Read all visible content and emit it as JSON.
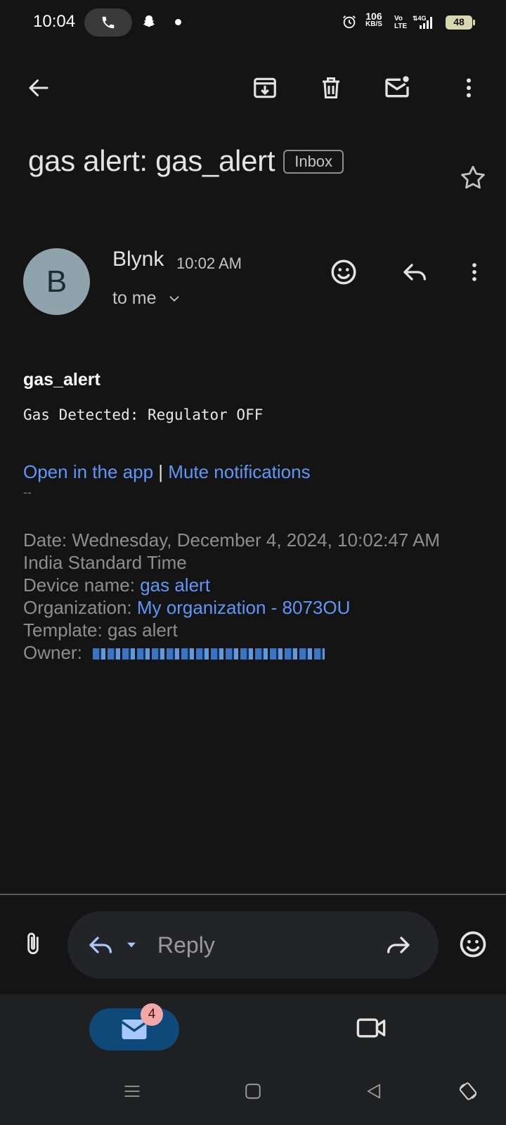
{
  "status_bar": {
    "time": "10:04",
    "net_speed_value": "106",
    "net_speed_unit": "KB/S",
    "volte_top": "Vo",
    "volte_bottom": "LTE",
    "network": "4G",
    "battery": "48",
    "icons": [
      "phone-icon",
      "snapchat-icon",
      "notification-dot",
      "alarm-icon",
      "signal-icon",
      "battery-icon"
    ]
  },
  "toolbar": {
    "icons": [
      "back-arrow-icon",
      "archive-icon",
      "delete-icon",
      "mark-unread-icon",
      "more-vert-icon"
    ]
  },
  "email": {
    "subject": "gas alert: gas_alert",
    "label": "Inbox",
    "sender": {
      "avatar_letter": "B",
      "avatar_color": "#8fa3ad",
      "name": "Blynk",
      "time": "10:02 AM",
      "recipient": "to me"
    },
    "body": {
      "title": "gas_alert",
      "message": "Gas Detected: Regulator OFF",
      "link_open": "Open in the app",
      "separator": "|",
      "link_mute": "Mute notifications",
      "signature_dash": "--",
      "date_label": "Date:",
      "date_value": "Wednesday, December 4, 2024, 10:02:47 AM",
      "timezone": "India Standard Time",
      "device_label": "Device name:",
      "device_value": "gas alert",
      "org_label": "Organization:",
      "org_value": "My organization - 8073OU",
      "template_label": "Template:",
      "template_value": "gas alert",
      "owner_label": "Owner:"
    }
  },
  "reply_bar": {
    "placeholder": "Reply"
  },
  "bottom_nav": {
    "mail_badge": "4",
    "accent": "#0d4a7a"
  },
  "colors": {
    "background": "#141414",
    "link": "#5e97f6"
  }
}
